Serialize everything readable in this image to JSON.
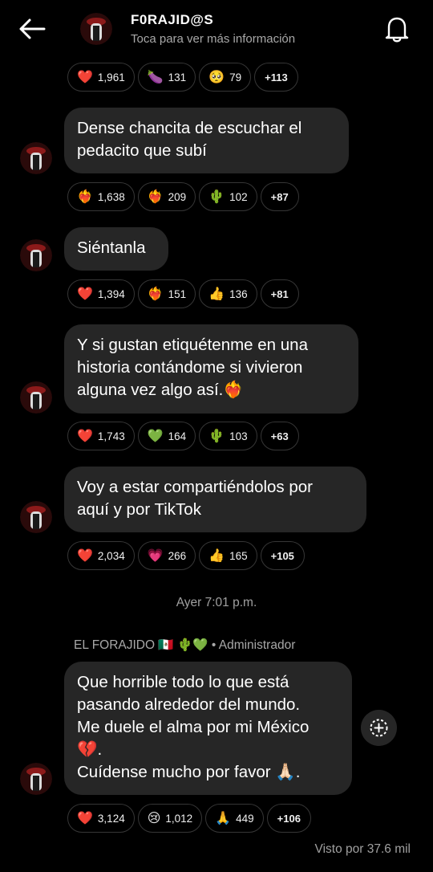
{
  "header": {
    "title": "F0RAJID@S",
    "subtitle": "Toca para ver más información"
  },
  "messages": [
    {
      "text": "",
      "reactions": [
        {
          "emoji": "❤️",
          "count": "1,961"
        },
        {
          "emoji": "🍆",
          "count": "131"
        },
        {
          "emoji": "🥺",
          "count": "79"
        },
        {
          "more": "+113"
        }
      ]
    },
    {
      "text": "Dense chancita de escuchar el\npedacito que subí",
      "reactions": [
        {
          "emoji": "❤️‍🔥",
          "count": "1,638"
        },
        {
          "emoji": "❤️‍🔥",
          "count": "209"
        },
        {
          "emoji": "🌵",
          "count": "102"
        },
        {
          "more": "+87"
        }
      ]
    },
    {
      "text": "Siéntanla",
      "reactions": [
        {
          "emoji": "❤️",
          "count": "1,394"
        },
        {
          "emoji": "❤️‍🔥",
          "count": "151"
        },
        {
          "emoji": "👍",
          "count": "136"
        },
        {
          "more": "+81"
        }
      ]
    },
    {
      "text": "Y si gustan etiquétenme en una\nhistoria contándome si vivieron\nalguna vez algo así.❤️‍🔥",
      "reactions": [
        {
          "emoji": "❤️",
          "count": "1,743"
        },
        {
          "emoji": "💚",
          "count": "164"
        },
        {
          "emoji": "🌵",
          "count": "103"
        },
        {
          "more": "+63"
        }
      ]
    },
    {
      "text": "Voy a estar compartiéndolos por\naquí y por TikTok",
      "reactions": [
        {
          "emoji": "❤️",
          "count": "2,034"
        },
        {
          "emoji": "💗",
          "count": "266"
        },
        {
          "emoji": "👍",
          "count": "165"
        },
        {
          "more": "+105"
        }
      ]
    },
    {
      "text": "Que horrible todo lo que está\npasando alrededor del mundo.\nMe duele el alma por mi México\n💔.\nCuídense mucho por favor 🙏🏻.",
      "reactions": [
        {
          "emoji": "❤️",
          "count": "3,124"
        },
        {
          "emoji": "😢",
          "count": "1,012"
        },
        {
          "emoji": "🙏",
          "count": "449"
        },
        {
          "more": "+106"
        }
      ]
    }
  ],
  "timestamp": "Ayer 7:01 p.m.",
  "sender_line": "EL FORAJIDO 🇲🇽 🌵💚 • Administrador",
  "seen": "Visto por 37.6 mil",
  "colors": {
    "background": "#000000",
    "bubble": "#262626",
    "muted": "#a8a8a8"
  }
}
